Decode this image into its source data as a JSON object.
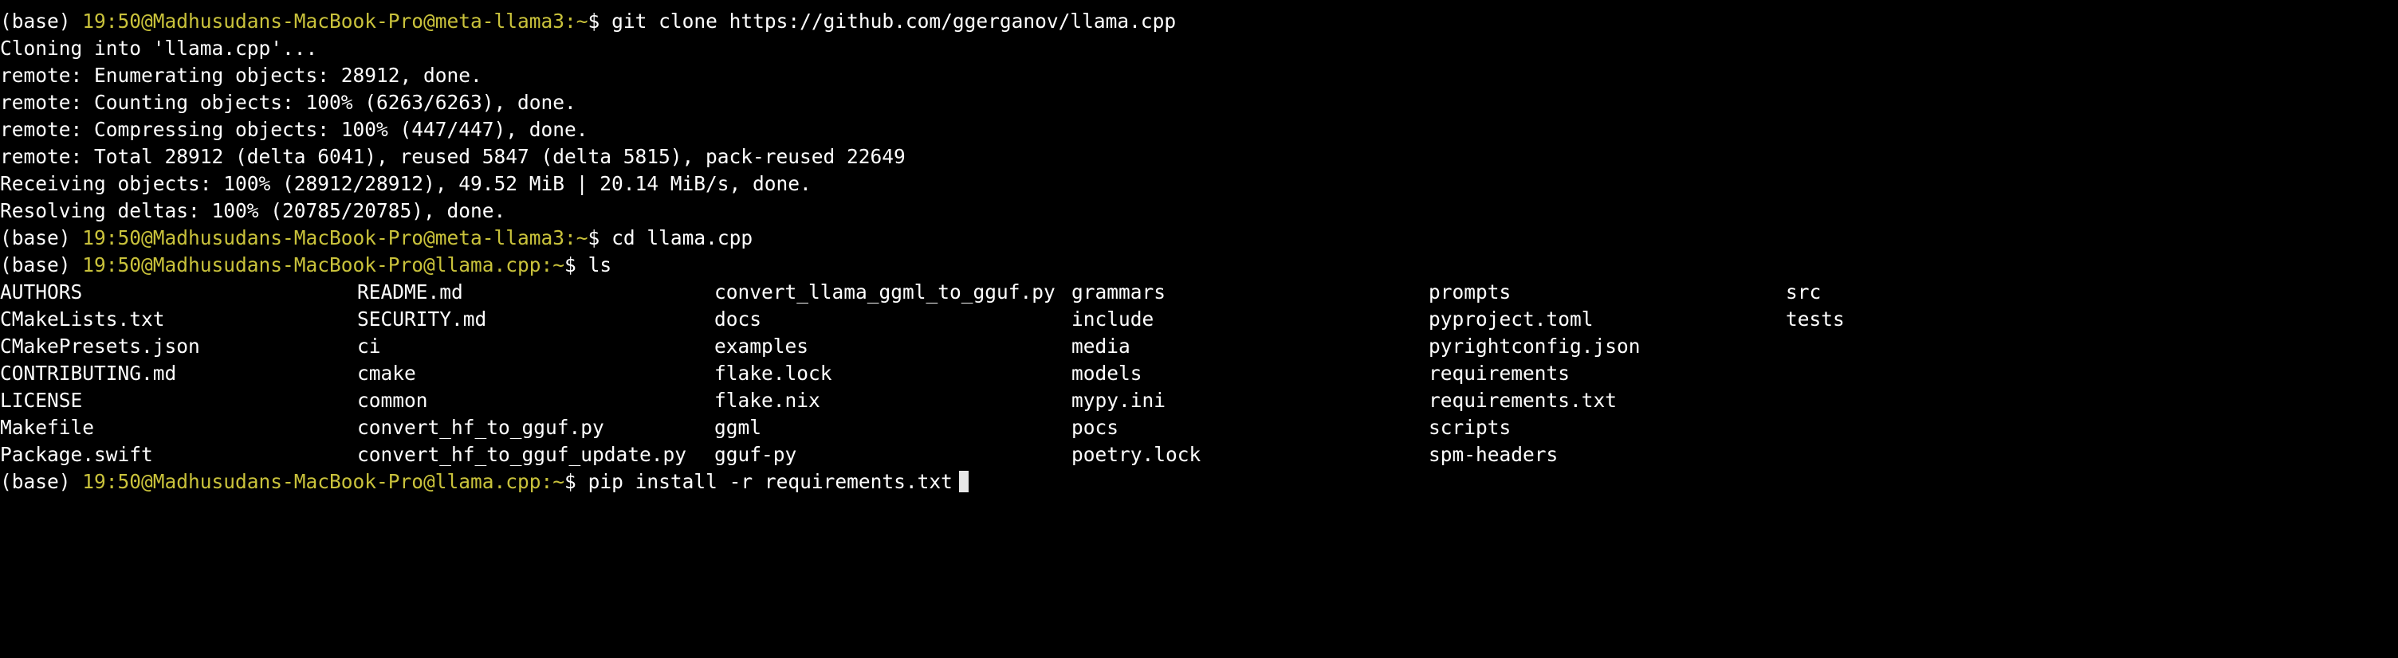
{
  "prompt": {
    "env": "(base) ",
    "user_host": "19:50@Madhusudans-MacBook-Pro",
    "symbol": "$ ",
    "colors": {
      "user_host": "#c9c23b",
      "dir": "#c9c23b",
      "text": "#ffffff",
      "background": "#000000"
    }
  },
  "commands": [
    {
      "dir": "@meta-llama3:~",
      "cmd": "git clone https://github.com/ggerganov/llama.cpp"
    },
    {
      "dir": "@meta-llama3:~",
      "cmd": "cd llama.cpp"
    },
    {
      "dir": "@llama.cpp:~",
      "cmd": "ls"
    },
    {
      "dir": "@llama.cpp:~",
      "cmd": "pip install -r requirements.txt"
    }
  ],
  "clone_output": [
    "Cloning into 'llama.cpp'...",
    "remote: Enumerating objects: 28912, done.",
    "remote: Counting objects: 100% (6263/6263), done.",
    "remote: Compressing objects: 100% (447/447), done.",
    "remote: Total 28912 (delta 6041), reused 5847 (delta 5815), pack-reused 22649",
    "Receiving objects: 100% (28912/28912), 49.52 MiB | 20.14 MiB/s, done.",
    "Resolving deltas: 100% (20785/20785), done."
  ],
  "ls_listing": [
    [
      "AUTHORS",
      "README.md",
      "convert_llama_ggml_to_gguf.py",
      "grammars",
      "prompts",
      "src"
    ],
    [
      "CMakeLists.txt",
      "SECURITY.md",
      "docs",
      "include",
      "pyproject.toml",
      "tests"
    ],
    [
      "CMakePresets.json",
      "ci",
      "examples",
      "media",
      "pyrightconfig.json",
      ""
    ],
    [
      "CONTRIBUTING.md",
      "cmake",
      "flake.lock",
      "models",
      "requirements",
      ""
    ],
    [
      "LICENSE",
      "common",
      "flake.nix",
      "mypy.ini",
      "requirements.txt",
      ""
    ],
    [
      "Makefile",
      "convert_hf_to_gguf.py",
      "ggml",
      "pocs",
      "scripts",
      ""
    ],
    [
      "Package.swift",
      "convert_hf_to_gguf_update.py",
      "gguf-py",
      "poetry.lock",
      "spm-headers",
      ""
    ]
  ]
}
